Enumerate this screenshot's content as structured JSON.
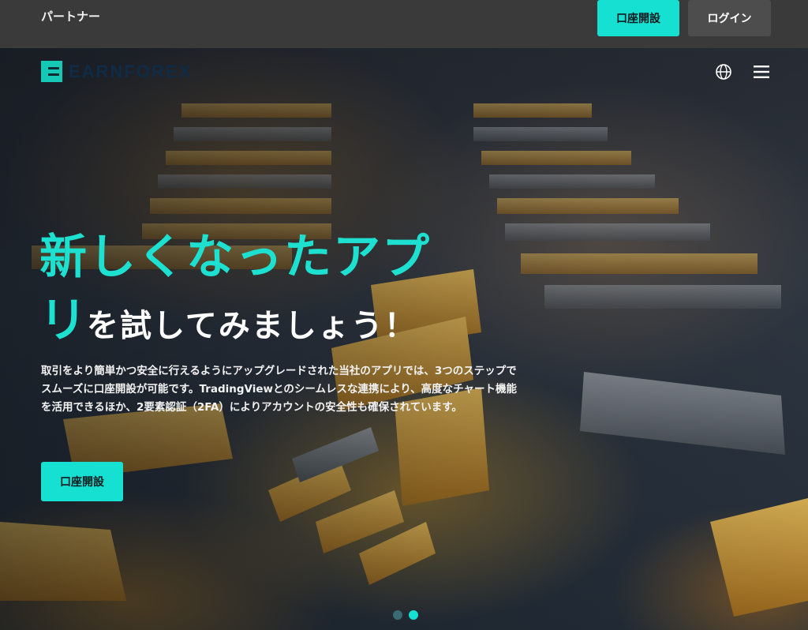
{
  "topbar": {
    "partner_label": "パートナー",
    "open_account_label": "口座開設",
    "login_label": "ログイン"
  },
  "brand": {
    "logo_text": "EARNFOREX"
  },
  "nav": {
    "icons": [
      "globe-icon",
      "menu-icon"
    ]
  },
  "hero": {
    "headline_line1": "新しくなったアプ",
    "headline_line2_teal": "リ",
    "headline_line2_white": "を試してみましょう！",
    "description": "取引をより簡単かつ安全に行えるようにアップグレードされた当社のアプリでは、3つのステップでスムーズに口座開設が可能です。TradingViewとのシームレスな連携により、高度なチャート機能を活用できるほか、2要素認証（2FA）によりアカウントの安全性も確保されています。",
    "cta_label": "口座開設"
  },
  "carousel": {
    "slides": 2,
    "active_index": 1
  },
  "colors": {
    "accent": "#16e0d2",
    "topbar_bg": "#3a3a3a",
    "login_bg": "#4d4d4d"
  }
}
